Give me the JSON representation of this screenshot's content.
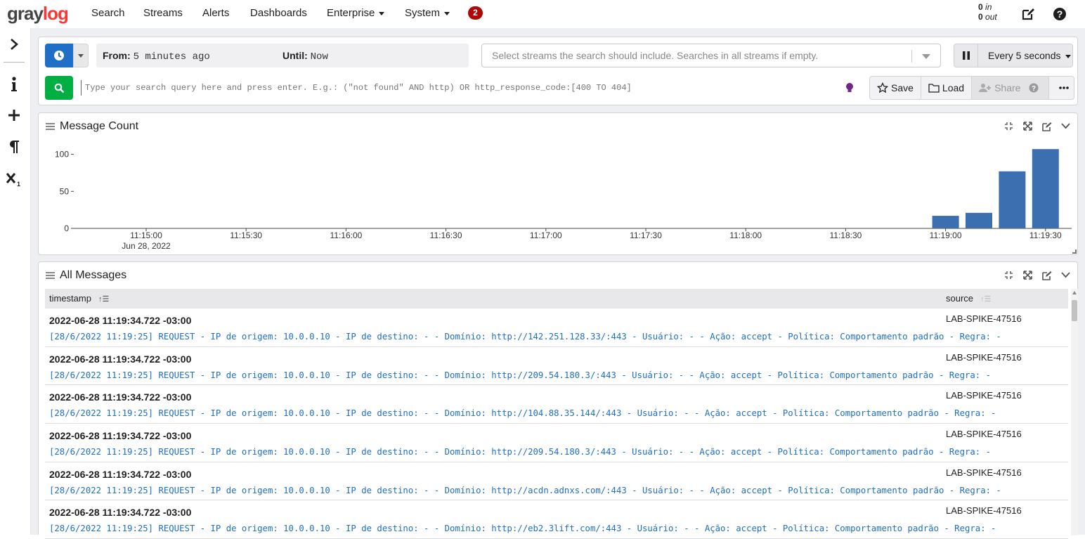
{
  "nav": {
    "logo_gray": "gray",
    "logo_log": "log",
    "items": [
      "Search",
      "Streams",
      "Alerts",
      "Dashboards",
      "Enterprise",
      "System"
    ],
    "notification_count": "2",
    "throughput_in_value": "0",
    "throughput_in_label": "in",
    "throughput_out_value": "0",
    "throughput_out_label": "out"
  },
  "sidebar": {
    "icons": [
      "chevron-right-icon",
      "info-icon",
      "plus-icon",
      "paragraph-icon",
      "subscript-x-icon"
    ]
  },
  "search": {
    "from_label": "From:",
    "from_value": "5 minutes ago",
    "until_label": "Until:",
    "until_value": "Now",
    "streams_placeholder": "Select streams the search should include. Searches in all streams if empty.",
    "refresh_label": "Every 5 seconds",
    "query_placeholder": "Type your search query here and press enter. E.g.: (\"not found\" AND http) OR http_response_code:[400 TO 404]",
    "save_label": "Save",
    "load_label": "Load",
    "share_label": "Share"
  },
  "colors": {
    "primary": "#1f6fc6",
    "search_green": "#00ae42",
    "badge_red": "#ad0707",
    "bar_blue": "#3c6faf",
    "logo_red": "#ff3633"
  },
  "widgets": {
    "message_count_title": "Message Count",
    "all_messages_title": "All Messages"
  },
  "chart_data": {
    "type": "bar",
    "title": "Message Count",
    "x_ticks": [
      "11:15:00",
      "11:15:30",
      "11:16:00",
      "11:16:30",
      "11:17:00",
      "11:17:30",
      "11:18:00",
      "11:18:30",
      "11:19:00",
      "11:19:30"
    ],
    "x_first_sublabel": "Jun 28, 2022",
    "y_ticks": [
      0,
      50,
      100
    ],
    "ylim": [
      0,
      110
    ],
    "bars": [
      {
        "x": "11:19:00",
        "value": 17
      },
      {
        "x": "11:19:10",
        "value": 21
      },
      {
        "x": "11:19:20",
        "value": 77
      },
      {
        "x": "11:19:30",
        "value": 107
      }
    ],
    "grid": false
  },
  "table": {
    "columns": [
      "timestamp",
      "source"
    ],
    "rows": [
      {
        "timestamp": "2022-06-28 11:19:34.722 -03:00",
        "source": "LAB-SPIKE-47516",
        "message": "[28/6/2022 11:19:25] REQUEST - IP de origem: 10.0.0.10 - IP de destino: - - Domínio: http://142.251.128.33/:443 - Usuário: - - Ação: accept - Política: Comportamento padrão - Regra: -"
      },
      {
        "timestamp": "2022-06-28 11:19:34.722 -03:00",
        "source": "LAB-SPIKE-47516",
        "message": "[28/6/2022 11:19:25] REQUEST - IP de origem: 10.0.0.10 - IP de destino: - - Domínio: http://209.54.180.3/:443 - Usuário: - - Ação: accept - Política: Comportamento padrão - Regra: -"
      },
      {
        "timestamp": "2022-06-28 11:19:34.722 -03:00",
        "source": "LAB-SPIKE-47516",
        "message": "[28/6/2022 11:19:25] REQUEST - IP de origem: 10.0.0.10 - IP de destino: - - Domínio: http://104.88.35.144/:443 - Usuário: - - Ação: accept - Política: Comportamento padrão - Regra: -"
      },
      {
        "timestamp": "2022-06-28 11:19:34.722 -03:00",
        "source": "LAB-SPIKE-47516",
        "message": "[28/6/2022 11:19:25] REQUEST - IP de origem: 10.0.0.10 - IP de destino: - - Domínio: http://209.54.180.3/:443 - Usuário: - - Ação: accept - Política: Comportamento padrão - Regra: -"
      },
      {
        "timestamp": "2022-06-28 11:19:34.722 -03:00",
        "source": "LAB-SPIKE-47516",
        "message": "[28/6/2022 11:19:25] REQUEST - IP de origem: 10.0.0.10 - IP de destino: - - Domínio: http://acdn.adnxs.com/:443 - Usuário: - - Ação: accept - Política: Comportamento padrão - Regra: -"
      },
      {
        "timestamp": "2022-06-28 11:19:34.722 -03:00",
        "source": "LAB-SPIKE-47516",
        "message": "[28/6/2022 11:19:25] REQUEST - IP de origem: 10.0.0.10 - IP de destino: - - Domínio: http://eb2.3lift.com/:443 - Usuário: - - Ação: accept - Política: Comportamento padrão - Regra: -"
      }
    ]
  }
}
